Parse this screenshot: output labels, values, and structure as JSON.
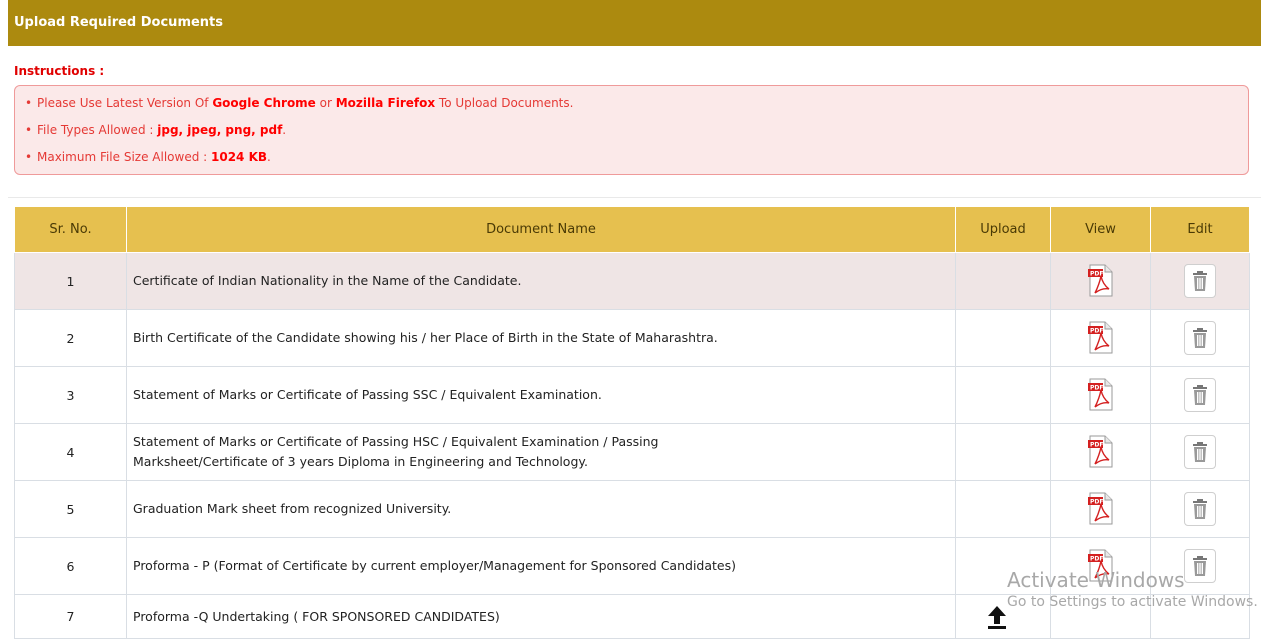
{
  "header": {
    "title": "Upload Required Documents"
  },
  "instructions": {
    "title": "Instructions :",
    "line1": {
      "pre": "Please Use Latest Version Of ",
      "b1": "Google Chrome",
      "mid": " or ",
      "b2": "Mozilla Firefox",
      "post": " To Upload Documents."
    },
    "line2": {
      "pre": "File Types Allowed : ",
      "b1": "jpg, jpeg, png, pdf",
      "post": "."
    },
    "line3": {
      "pre": "Maximum File Size Allowed : ",
      "b1": "1024 KB",
      "post": "."
    }
  },
  "table": {
    "headers": {
      "sr": "Sr. No.",
      "name": "Document Name",
      "upload": "Upload",
      "view": "View",
      "edit": "Edit"
    },
    "rows": [
      {
        "sr": "1",
        "name": "Certificate of Indian Nationality in the Name of the Candidate."
      },
      {
        "sr": "2",
        "name": "Birth Certificate of the Candidate showing his / her Place of Birth in the State of Maharashtra."
      },
      {
        "sr": "3",
        "name": "Statement of Marks or Certificate of Passing SSC / Equivalent Examination."
      },
      {
        "sr": "4",
        "name_line1": "Statement of Marks or Certificate of Passing HSC / Equivalent Examination / Passing",
        "name_line2": "Marksheet/Certificate of 3 years Diploma in Engineering and Technology."
      },
      {
        "sr": "5",
        "name": "Graduation Mark sheet from recognized University."
      },
      {
        "sr": "6",
        "name": "Proforma - P (Format of Certificate by current employer/Management for Sponsored Candidates)"
      },
      {
        "sr": "7",
        "name": "Proforma -Q Undertaking ( FOR SPONSORED CANDIDATES)"
      }
    ]
  },
  "icons": {
    "pdf": "pdf-file-icon",
    "delete": "trash-icon",
    "upload": "upload-arrow-icon"
  },
  "colors": {
    "header_bg": "#ac8a0f",
    "table_header_bg": "#e6c04f",
    "instruction_text": "#e53935",
    "instruction_box_bg": "#fbe9e9"
  },
  "watermark": {
    "line1": "Activate Windows",
    "line2": "Go to Settings to activate Windows."
  }
}
